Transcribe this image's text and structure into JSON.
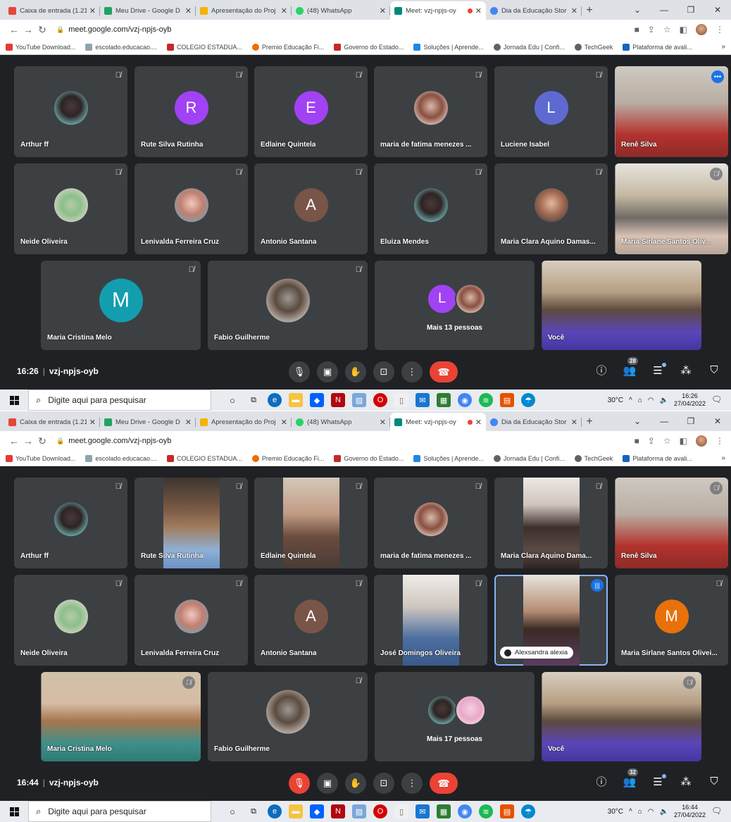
{
  "screens": [
    {
      "tabs": [
        {
          "label": "Caixa de entrada (1.21",
          "color": "#e8453c"
        },
        {
          "label": "Meu Drive - Google D",
          "color": "#1fa463"
        },
        {
          "label": "Apresentação do Proj",
          "color": "#f4b400"
        },
        {
          "label": "(48) WhatsApp",
          "color": "#25d366"
        },
        {
          "label": "Meet: vzj-npjs-oy",
          "color": "#00897b"
        },
        {
          "label": "Dia da Educação Stor",
          "color": "#4285f4"
        }
      ],
      "url": "meet.google.com/vzj-npjs-oyb",
      "bookmarks": [
        {
          "label": "YouTube Download...",
          "color": "#e53935"
        },
        {
          "label": "escolado.educacao....",
          "color": "#90a4ae"
        },
        {
          "label": "COLEGIO ESTADUA...",
          "color": "#c62828"
        },
        {
          "label": "Premio Educação Fi...",
          "color": "#ef6c00"
        },
        {
          "label": "Governo do Estado...",
          "color": "#c62828"
        },
        {
          "label": "Soluções | Aprende...",
          "color": "#1e88e5"
        },
        {
          "label": "Jornada Edu | Confi...",
          "color": "#5f6368"
        },
        {
          "label": "TechGeek",
          "color": "#5f6368"
        },
        {
          "label": "Plataforma de avali...",
          "color": "#1565c0"
        }
      ],
      "participants": [
        {
          "name": "Arthur ff",
          "initial": "",
          "color": ""
        },
        {
          "name": "Rute Silva Rutinha",
          "initial": "R",
          "color": "#a142f4"
        },
        {
          "name": "Edlaine Quintela",
          "initial": "E",
          "color": "#a142f4"
        },
        {
          "name": "maria de fatima menezes ...",
          "initial": "",
          "color": ""
        },
        {
          "name": "Luciene Isabel",
          "initial": "L",
          "color": "#5e6ad2"
        },
        {
          "name": "Renê Silva",
          "initial": "",
          "color": ""
        },
        {
          "name": "Neide Oliveira",
          "initial": "",
          "color": ""
        },
        {
          "name": "Lenivalda Ferreira Cruz",
          "initial": "",
          "color": ""
        },
        {
          "name": "Antonio Santana",
          "initial": "A",
          "color": "#795548"
        },
        {
          "name": "Eluiza Mendes",
          "initial": "",
          "color": ""
        },
        {
          "name": "Maria Clara Aquino Damas...",
          "initial": "",
          "color": ""
        },
        {
          "name": "Maria Sirlane Santos Oliv...",
          "initial": "",
          "color": ""
        },
        {
          "name": "Maria Cristina Melo",
          "initial": "M",
          "color": "#129eaf"
        },
        {
          "name": "Fabio Guilherme",
          "initial": "",
          "color": ""
        },
        {
          "name": "Você",
          "initial": "",
          "color": ""
        }
      ],
      "more": {
        "label": "Mais 13 pessoas",
        "initial": "L",
        "color": "#a142f4"
      },
      "time": "16:26",
      "meeting_code": "vzj-npjs-oyb",
      "people_count": "28",
      "taskbar_search": "Digite aqui para pesquisar",
      "temp": "30°C",
      "clock_time": "16:26",
      "clock_date": "27/04/2022"
    },
    {
      "tabs": [
        {
          "label": "Caixa de entrada (1.21",
          "color": "#e8453c"
        },
        {
          "label": "Meu Drive - Google D",
          "color": "#1fa463"
        },
        {
          "label": "Apresentação do Proj",
          "color": "#f4b400"
        },
        {
          "label": "(48) WhatsApp",
          "color": "#25d366"
        },
        {
          "label": "Meet: vzj-npjs-oy",
          "color": "#00897b"
        },
        {
          "label": "Dia da Educação Stor",
          "color": "#4285f4"
        }
      ],
      "url": "meet.google.com/vzj-npjs-oyb",
      "bookmarks": [
        {
          "label": "YouTube Download...",
          "color": "#e53935"
        },
        {
          "label": "escolado.educacao....",
          "color": "#90a4ae"
        },
        {
          "label": "COLEGIO ESTADUA...",
          "color": "#c62828"
        },
        {
          "label": "Premio Educação Fi...",
          "color": "#ef6c00"
        },
        {
          "label": "Governo do Estado...",
          "color": "#c62828"
        },
        {
          "label": "Soluções | Aprende...",
          "color": "#1e88e5"
        },
        {
          "label": "Jornada Edu | Confi...",
          "color": "#5f6368"
        },
        {
          "label": "TechGeek",
          "color": "#5f6368"
        },
        {
          "label": "Plataforma de avali...",
          "color": "#1565c0"
        }
      ],
      "participants": [
        {
          "name": "Arthur ff",
          "initial": "",
          "color": ""
        },
        {
          "name": "Rute Silva Rutinha",
          "initial": "",
          "color": ""
        },
        {
          "name": "Edlaine Quintela",
          "initial": "",
          "color": ""
        },
        {
          "name": "maria de fatima menezes ...",
          "initial": "",
          "color": ""
        },
        {
          "name": "Maria Clara Aquino Dama...",
          "initial": "",
          "color": ""
        },
        {
          "name": "Renê Silva",
          "initial": "",
          "color": ""
        },
        {
          "name": "Neide Oliveira",
          "initial": "",
          "color": ""
        },
        {
          "name": "Lenivalda Ferreira Cruz",
          "initial": "",
          "color": ""
        },
        {
          "name": "Antonio Santana",
          "initial": "A",
          "color": "#795548"
        },
        {
          "name": "José Domingos Oliveira",
          "initial": "",
          "color": ""
        },
        {
          "name": "Alexsandra alexia",
          "initial": "",
          "color": ""
        },
        {
          "name": "Maria Sirlane Santos Olivei...",
          "initial": "M",
          "color": "#e8710a"
        },
        {
          "name": "Maria Cristina Melo",
          "initial": "",
          "color": ""
        },
        {
          "name": "Fabio Guilherme",
          "initial": "",
          "color": ""
        },
        {
          "name": "Você",
          "initial": "",
          "color": ""
        }
      ],
      "more": {
        "label": "Mais 17 pessoas",
        "initial": "",
        "color": ""
      },
      "time": "16:44",
      "meeting_code": "vzj-npjs-oyb",
      "people_count": "32",
      "taskbar_search": "Digite aqui para pesquisar",
      "temp": "30°C",
      "clock_time": "16:44",
      "clock_date": "27/04/2022"
    }
  ]
}
